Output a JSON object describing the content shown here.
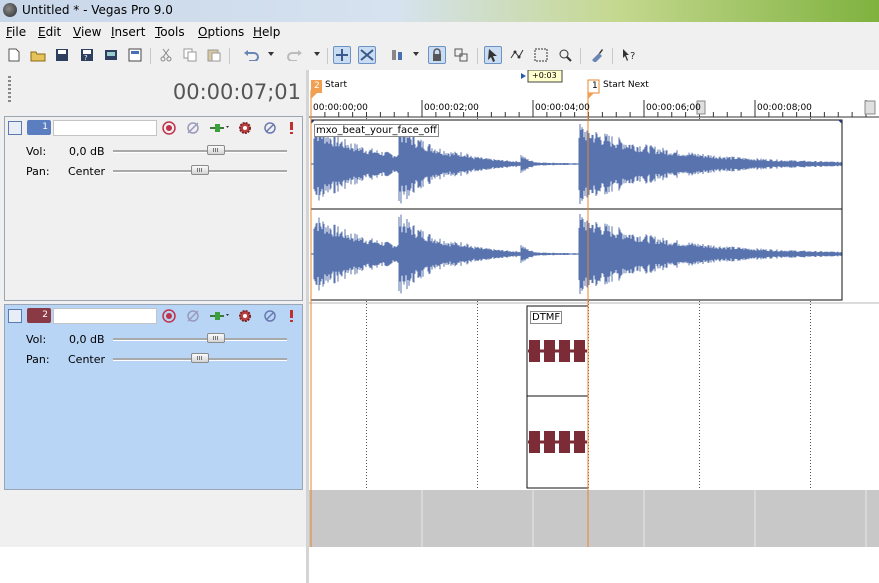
{
  "window": {
    "title": "Untitled * - Vegas Pro 9.0"
  },
  "menu": [
    "File",
    "Edit",
    "View",
    "Insert",
    "Tools",
    "Options",
    "Help"
  ],
  "toolbar": {
    "buttons": [
      {
        "icon": "new-project-icon"
      },
      {
        "icon": "open-icon"
      },
      {
        "icon": "save-icon"
      },
      {
        "icon": "save-as-icon"
      },
      {
        "icon": "render-as-icon"
      },
      {
        "icon": "properties-icon"
      },
      {
        "icon": "cut-icon"
      },
      {
        "icon": "copy-icon"
      },
      {
        "icon": "paste-icon"
      },
      {
        "icon": "undo-icon"
      },
      {
        "icon": "redo-icon"
      },
      {
        "icon": "enable-snapping-icon"
      },
      {
        "icon": "auto-crossfades-icon"
      },
      {
        "icon": "auto-ripple-icon"
      },
      {
        "icon": "lock-envelopes-icon"
      },
      {
        "icon": "ignore-grouping-icon"
      },
      {
        "icon": "normal-edit-tool-icon"
      },
      {
        "icon": "envelope-edit-tool-icon"
      },
      {
        "icon": "selection-edit-tool-icon"
      },
      {
        "icon": "zoom-edit-tool-icon"
      },
      {
        "icon": "plug-in-manager-icon"
      },
      {
        "icon": "whats-this-help-icon"
      }
    ]
  },
  "time_display": "00:00:07;01",
  "tracks": [
    {
      "number": "1",
      "name": "",
      "vol_label": "Vol:",
      "vol_value": "0,0 dB",
      "pan_label": "Pan:",
      "pan_value": "Center",
      "vol_level": 0.6,
      "pan_level": 0.5,
      "color": "#5b7ec0",
      "selected": false
    },
    {
      "number": "2",
      "name": "",
      "vol_label": "Vol:",
      "vol_value": "0,0 dB",
      "pan_label": "Pan:",
      "pan_value": "Center",
      "vol_level": 0.6,
      "pan_level": 0.5,
      "color": "#8a3a45",
      "selected": true
    }
  ],
  "markers": [
    {
      "number": "2",
      "label": "Start",
      "color": "#f0a050"
    },
    {
      "number": "1",
      "label": "Start Next",
      "color": "#f0a050"
    }
  ],
  "time_offset": "+0:03",
  "ruler_ticks": [
    "00:00:00;00",
    "00:00:02;00",
    "00:00:04;00",
    "00:00:06;00",
    "00:00:08;00"
  ],
  "events": [
    {
      "name": "mxo_beat_your_face_off",
      "color": "#5873ad"
    },
    {
      "name": "DTMF",
      "color": "#7c2c36"
    }
  ],
  "colors": {
    "cursor": "#e8862a",
    "selected_track": "#b8d5f5",
    "empty_area": "#c8c8c8"
  }
}
